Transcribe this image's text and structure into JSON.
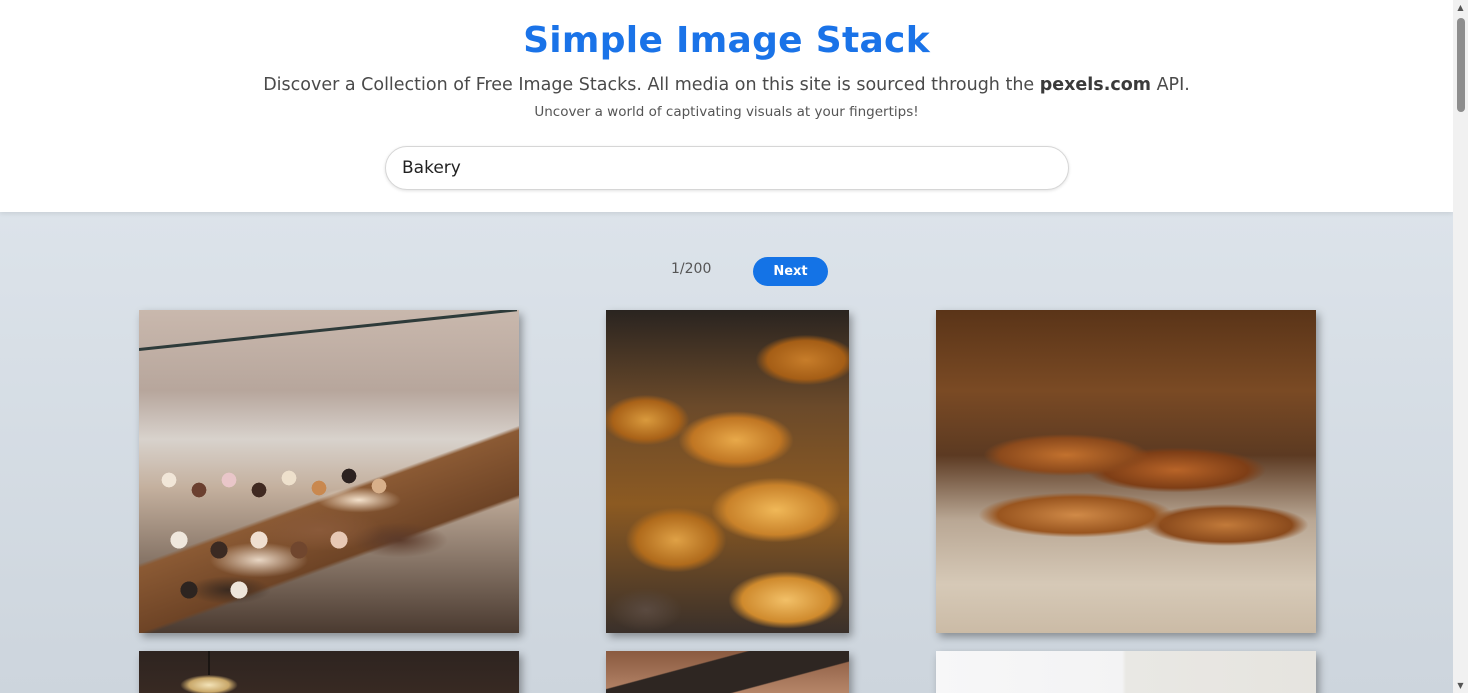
{
  "header": {
    "title": "Simple Image Stack",
    "subtitle_prefix": "Discover a Collection of Free Image Stacks. All media on this site is sourced through the ",
    "subtitle_brand": "pexels.com",
    "subtitle_suffix": " API.",
    "tagline": "Uncover a world of captivating visuals at your fingertips!"
  },
  "search": {
    "value": "Bakery"
  },
  "pagination": {
    "current": "1/200",
    "next_label": "Next"
  },
  "gallery": {
    "photos": [
      {
        "subject": "bakery display case with donuts and pastries"
      },
      {
        "subject": "croissants"
      },
      {
        "subject": "baguettes on linen"
      },
      {
        "subject": "pendant lamp interior"
      },
      {
        "subject": "cafe sign"
      },
      {
        "subject": "white wall"
      }
    ]
  },
  "colors": {
    "accent": "#1a73e8",
    "button": "#1473e6",
    "background": "#d6dee5"
  },
  "icons": {
    "scroll_up": "chevron-up-icon",
    "scroll_down": "chevron-down-icon"
  }
}
